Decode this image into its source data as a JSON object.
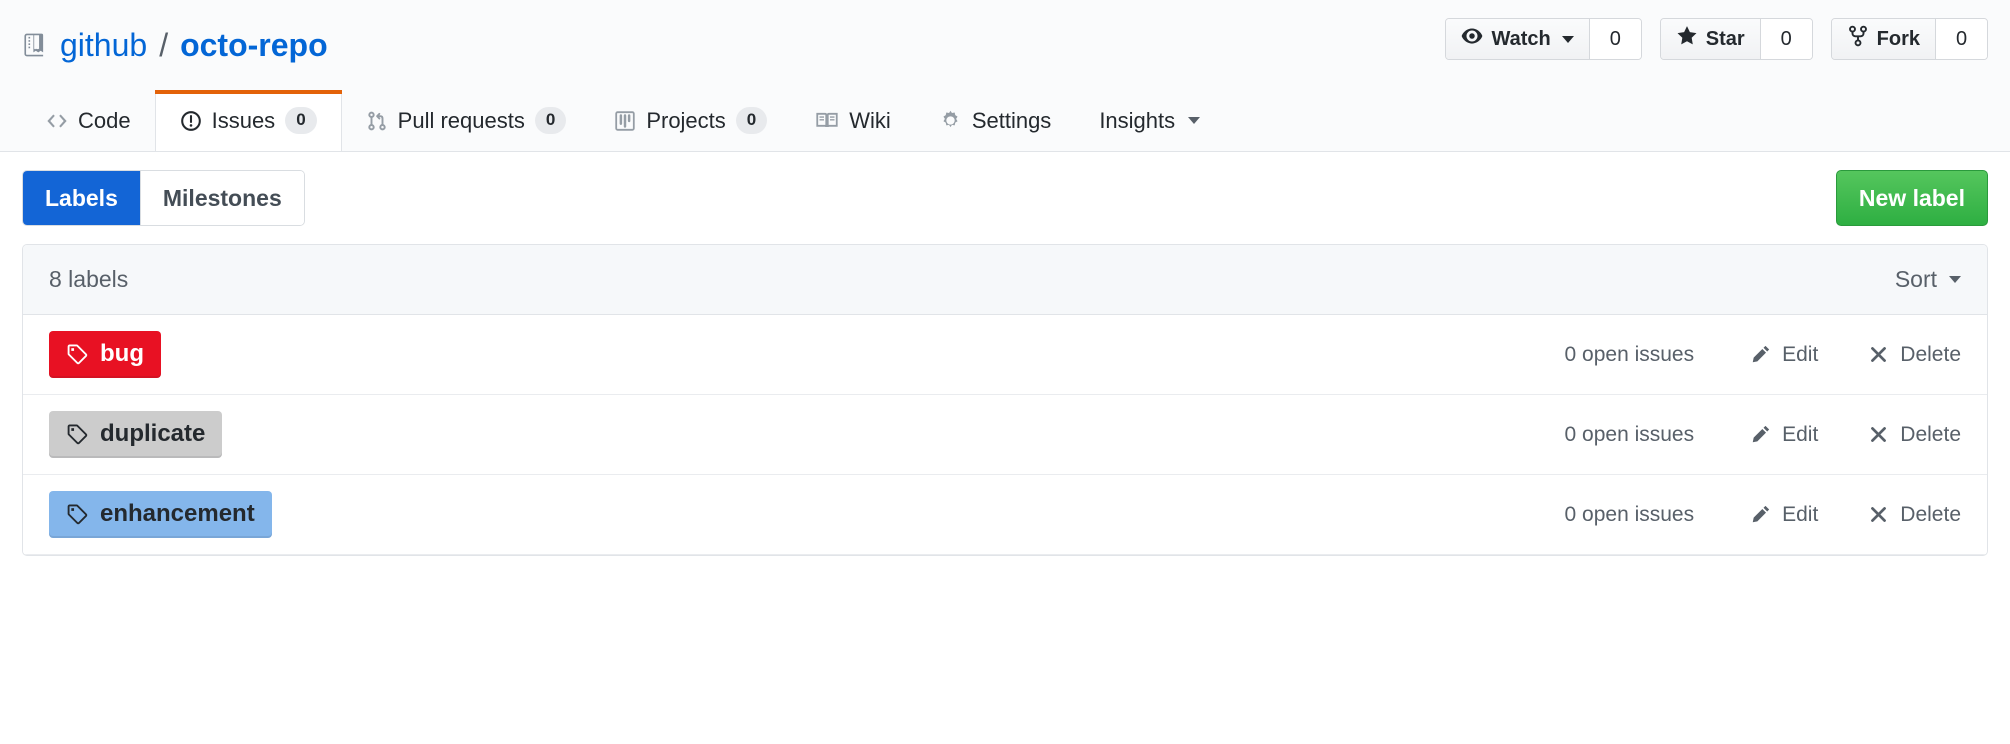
{
  "header": {
    "repo_icon": "repo-book-icon",
    "owner": "github",
    "separator": "/",
    "repo_name": "octo-repo",
    "actions": [
      {
        "icon": "eye-icon",
        "label": "Watch",
        "count": "0",
        "has_caret": true
      },
      {
        "icon": "star-icon",
        "label": "Star",
        "count": "0",
        "has_caret": false
      },
      {
        "icon": "repo-forked-icon",
        "label": "Fork",
        "count": "0",
        "has_caret": false
      }
    ]
  },
  "nav": {
    "items": [
      {
        "icon": "code-icon",
        "label": "Code",
        "count": null,
        "selected": false,
        "has_caret": false
      },
      {
        "icon": "issue-opened-icon",
        "label": "Issues",
        "count": "0",
        "selected": true,
        "has_caret": false
      },
      {
        "icon": "git-pull-request-icon",
        "label": "Pull requests",
        "count": "0",
        "selected": false,
        "has_caret": false
      },
      {
        "icon": "project-icon",
        "label": "Projects",
        "count": "0",
        "selected": false,
        "has_caret": false
      },
      {
        "icon": "book-icon",
        "label": "Wiki",
        "count": null,
        "selected": false,
        "has_caret": false
      },
      {
        "icon": "gear-icon",
        "label": "Settings",
        "count": null,
        "selected": false,
        "has_caret": false
      },
      {
        "icon": null,
        "label": "Insights",
        "count": null,
        "selected": false,
        "has_caret": true
      }
    ],
    "active_accent": "#e36209"
  },
  "subnav": {
    "toggle": [
      {
        "label": "Labels",
        "active": true
      },
      {
        "label": "Milestones",
        "active": false
      }
    ],
    "active_color": "#1365d6",
    "new_label_button": "New label",
    "new_label_color": "#2eaf42"
  },
  "labels_panel": {
    "count_text": "8 labels",
    "sort_label": "Sort",
    "sort_icon": "chevron-down-icon",
    "rows": [
      {
        "name": "bug",
        "bg": "#e81123",
        "text_color": "#ffffff",
        "tag_icon": "tag-icon",
        "open_issues": "0 open issues",
        "edit_label": "Edit",
        "edit_icon": "pencil-icon",
        "delete_label": "Delete",
        "delete_icon": "x-icon"
      },
      {
        "name": "duplicate",
        "bg": "#cccccc",
        "text_color": "#24292e",
        "tag_icon": "tag-icon",
        "open_issues": "0 open issues",
        "edit_label": "Edit",
        "edit_icon": "pencil-icon",
        "delete_label": "Delete",
        "delete_icon": "x-icon"
      },
      {
        "name": "enhancement",
        "bg": "#84b6eb",
        "text_color": "#24292e",
        "tag_icon": "tag-icon",
        "open_issues": "0 open issues",
        "edit_label": "Edit",
        "edit_icon": "pencil-icon",
        "delete_label": "Delete",
        "delete_icon": "x-icon"
      }
    ]
  }
}
